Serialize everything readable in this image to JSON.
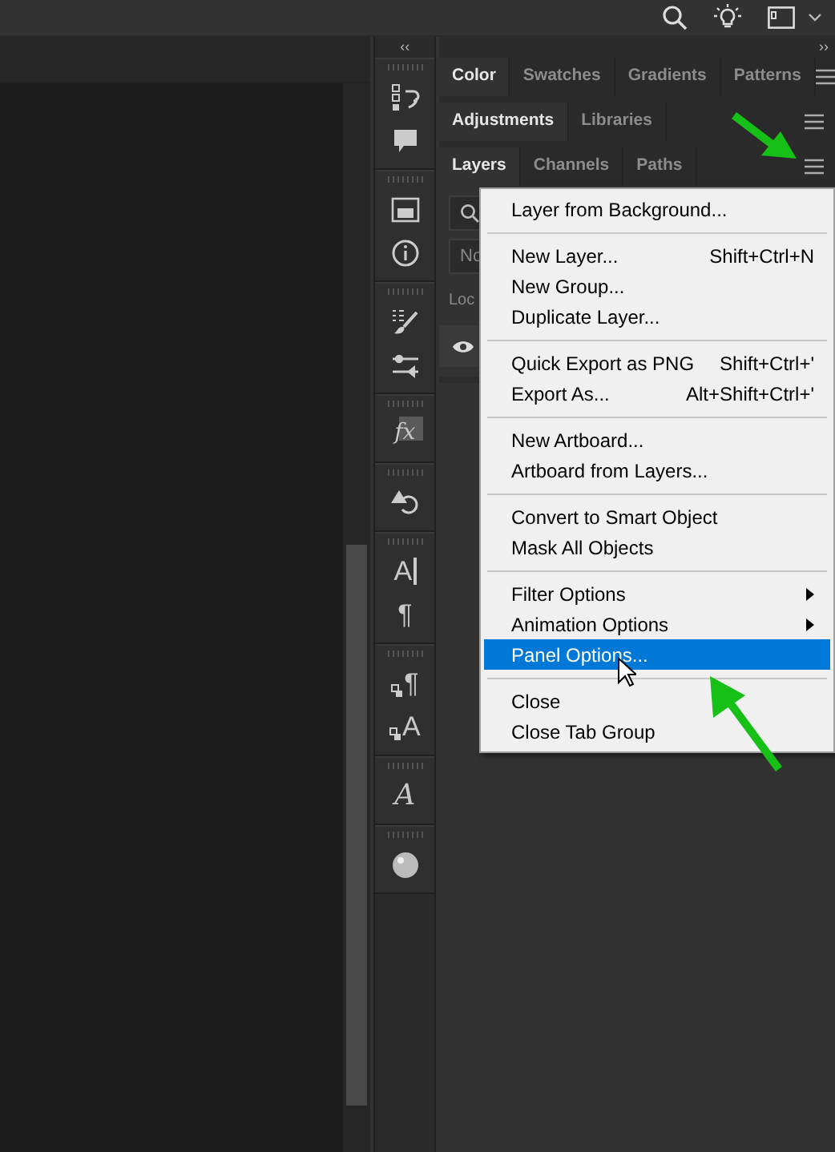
{
  "dock": {
    "collapse": "‹‹",
    "expand": "››"
  },
  "tool_glyphs": {
    "styles": "fx",
    "character": "A",
    "paragraph": "¶",
    "paragraph_styles": "¶",
    "character_styles": "A",
    "glyphs": "A"
  },
  "panel_groups": [
    {
      "tabs": [
        {
          "label": "Color",
          "selected": true
        },
        {
          "label": "Swatches",
          "selected": false
        },
        {
          "label": "Gradients",
          "selected": false
        },
        {
          "label": "Patterns",
          "selected": false
        }
      ]
    },
    {
      "tabs": [
        {
          "label": "Adjustments",
          "selected": true
        },
        {
          "label": "Libraries",
          "selected": false
        }
      ]
    },
    {
      "tabs": [
        {
          "label": "Layers",
          "selected": true
        },
        {
          "label": "Channels",
          "selected": false
        },
        {
          "label": "Paths",
          "selected": false
        }
      ]
    }
  ],
  "layers_panel": {
    "blend_mode": "No",
    "lock_label": "Loc"
  },
  "menu": [
    {
      "kind": "item",
      "label": "Layer from Background...",
      "selected": false
    },
    {
      "kind": "separator"
    },
    {
      "kind": "item",
      "label": "New Layer...",
      "shortcut": "Shift+Ctrl+N",
      "selected": false
    },
    {
      "kind": "item",
      "label": "New Group...",
      "selected": false
    },
    {
      "kind": "item",
      "label": "Duplicate Layer...",
      "selected": false
    },
    {
      "kind": "separator"
    },
    {
      "kind": "item",
      "label": "Quick Export as PNG",
      "shortcut": "Shift+Ctrl+'",
      "selected": false
    },
    {
      "kind": "item",
      "label": "Export As...",
      "shortcut": "Alt+Shift+Ctrl+'",
      "selected": false
    },
    {
      "kind": "separator"
    },
    {
      "kind": "item",
      "label": "New Artboard...",
      "selected": false
    },
    {
      "kind": "item",
      "label": "Artboard from Layers...",
      "selected": false
    },
    {
      "kind": "separator"
    },
    {
      "kind": "item",
      "label": "Convert to Smart Object",
      "selected": false
    },
    {
      "kind": "item",
      "label": "Mask All Objects",
      "selected": false
    },
    {
      "kind": "separator"
    },
    {
      "kind": "item",
      "label": "Filter Options",
      "submenu": true,
      "selected": false
    },
    {
      "kind": "item",
      "label": "Animation Options",
      "submenu": true,
      "selected": false
    },
    {
      "kind": "item",
      "label": "Panel Options...",
      "selected": true
    },
    {
      "kind": "separator"
    },
    {
      "kind": "item",
      "label": "Close",
      "selected": false
    },
    {
      "kind": "item",
      "label": "Close Tab Group",
      "selected": false
    }
  ]
}
